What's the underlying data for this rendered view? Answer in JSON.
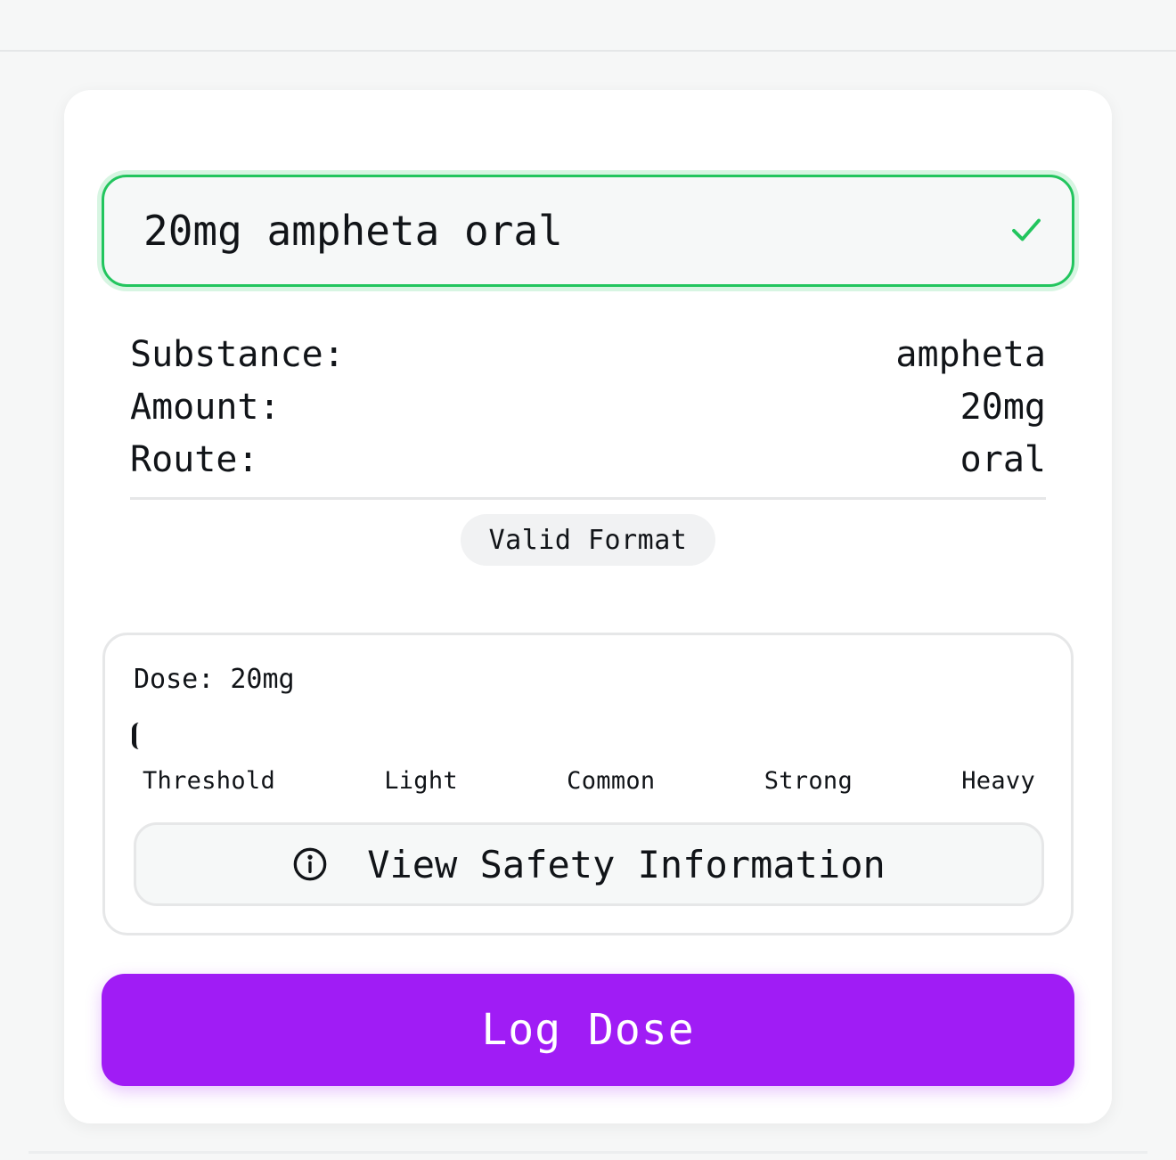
{
  "input": {
    "value": "20mg ampheta oral"
  },
  "parsed": {
    "rows": [
      {
        "label": "Substance:",
        "value": "ampheta"
      },
      {
        "label": "Amount:",
        "value": "20mg"
      },
      {
        "label": "Route:",
        "value": "oral"
      }
    ]
  },
  "status_badge": "Valid Format",
  "dose": {
    "label": "Dose:",
    "value": "20mg",
    "scale": [
      "Threshold",
      "Light",
      "Common",
      "Strong",
      "Heavy"
    ]
  },
  "safety_button": "View Safety Information",
  "log_button": "Log Dose",
  "colors": {
    "valid": "#22c55e",
    "primary": "#a01cf5"
  },
  "icons": {
    "valid": "check-icon",
    "safety": "info-icon"
  }
}
